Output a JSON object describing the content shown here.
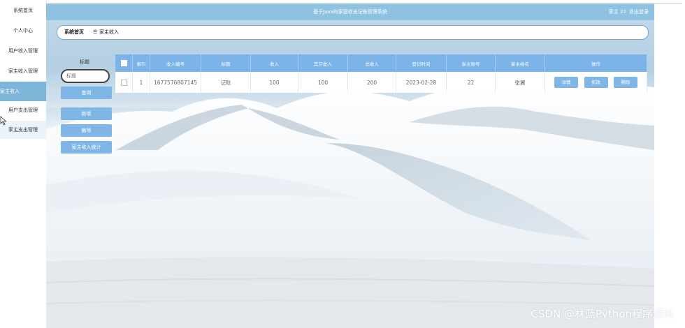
{
  "sidebar": {
    "items": [
      {
        "label": "系统首页"
      },
      {
        "label": "个人中心"
      },
      {
        "label": "用户收入管理"
      },
      {
        "label": "家主收入管理"
      },
      {
        "label": "家主收入"
      },
      {
        "label": "用户支出管理"
      },
      {
        "label": "家主支出管理"
      }
    ]
  },
  "header": {
    "title": "基于Java的家庭收支记账管理系统",
    "user": "家主 22",
    "logout": "退出登录"
  },
  "breadcrumb": {
    "home": "系统首页",
    "separator": "☰",
    "current": "家主收入"
  },
  "search": {
    "label": "标题",
    "placeholder": "标题",
    "query_button": "查询",
    "add_button": "新增",
    "delete_button": "删除",
    "stats_button": "家主收入统计"
  },
  "table": {
    "columns": [
      "索引",
      "收入编号",
      "标题",
      "收入",
      "其它收入",
      "总收入",
      "登记时间",
      "家主账号",
      "家主姓名",
      "操作"
    ],
    "rows": [
      {
        "index": "1",
        "income_no": "1677576807145",
        "title": "记账",
        "income": "100",
        "other_income": "100",
        "total_income": "200",
        "date": "2023-02-28",
        "account": "22",
        "name": "张翼"
      }
    ],
    "row_actions": {
      "detail": "详情",
      "edit": "修改",
      "delete": "删除"
    }
  },
  "watermark": "CSDN @林蓝Python程序源码",
  "colors": {
    "accent": "#7fb6e6",
    "header": "#8fc2e0",
    "sidebar_active": "#7db6d8"
  }
}
